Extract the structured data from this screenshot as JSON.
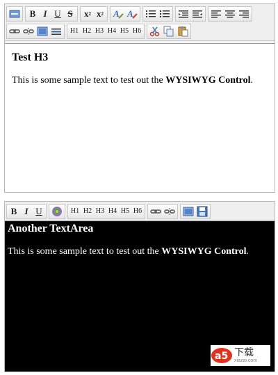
{
  "editor1": {
    "toolbar_row1": {
      "bold": "B",
      "italic": "I",
      "underline": "U",
      "strike": "S",
      "subscript": "x",
      "subscript_mark": "2",
      "superscript": "x",
      "superscript_mark": "2"
    },
    "toolbar_row2": {
      "headings": [
        "H1",
        "H2",
        "H3",
        "H4",
        "H5",
        "H6"
      ]
    },
    "content": {
      "heading": "Test H3",
      "text_before": "This is some sample text to test out the ",
      "text_bold": "WYSIWYG Control",
      "text_after": "."
    },
    "background": "#ffffff",
    "text_color": "#000000"
  },
  "editor2": {
    "toolbar": {
      "bold": "B",
      "italic": "I",
      "underline": "U",
      "headings": [
        "H1",
        "H2",
        "H3",
        "H4",
        "H5",
        "H6"
      ]
    },
    "content": {
      "heading": "Another TextArea",
      "text_before": "This is some sample text to test out the ",
      "text_bold": "WYSIWYG Control",
      "text_after": "."
    },
    "background": "#000000",
    "text_color": "#ffffff"
  },
  "watermark": {
    "logo_text": "a5",
    "name": "下载",
    "url": "xiazai.com"
  },
  "colors": {
    "accent_red": "#e0321e",
    "icon_blue": "#4a7cc0",
    "toolbar_bg": "#efefef"
  }
}
